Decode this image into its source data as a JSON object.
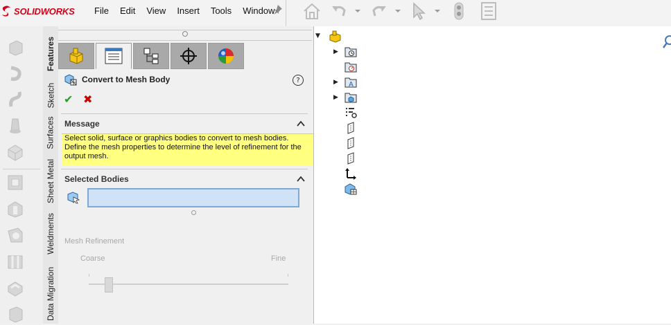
{
  "app": {
    "brand": "SOLIDWORKS",
    "brand_prefix": "3S",
    "brand_color": "#d0021b"
  },
  "menu": {
    "items": [
      "File",
      "Edit",
      "View",
      "Insert",
      "Tools",
      "Window"
    ]
  },
  "toolbar": {
    "icons": [
      "home-icon",
      "undo-icon",
      "dropdown-icon",
      "redo-icon",
      "dropdown-icon",
      "select-icon",
      "dropdown-icon",
      "toggle-icon",
      "options-icon"
    ]
  },
  "left_icons": [
    "extrude-boss-icon",
    "revolve-boss-icon",
    "sweep-boss-icon",
    "loft-boss-icon",
    "boundary-boss-icon",
    "extrude-cut-icon",
    "hole-wizard-icon",
    "revolve-cut-icon",
    "swept-cut-icon",
    "lofted-cut-icon",
    "boundary-cut-icon"
  ],
  "vertical_tabs": [
    "Features",
    "Sketch",
    "Surfaces",
    "Sheet Metal",
    "Weldments",
    "Data Migration"
  ],
  "manager_tabs": [
    "feature-manager-icon",
    "property-manager-icon",
    "configuration-manager-icon",
    "dimxpert-manager-icon",
    "display-manager-icon"
  ],
  "property_manager": {
    "title": "Convert to Mesh Body",
    "help": "?",
    "ok": "✔",
    "cancel": "✖",
    "message": {
      "title": "Message",
      "text": "Select solid, surface or graphics bodies to convert to mesh bodies. Define the mesh properties to determine the level of refinement for the output mesh."
    },
    "selected_bodies": {
      "title": "Selected Bodies",
      "value": ""
    },
    "mesh_refinement": {
      "title": "Mesh Refinement",
      "coarse_label": "Coarse",
      "fine_label": "Fine",
      "level": 0.1
    }
  },
  "feature_tree": {
    "items": [
      {
        "icon": "part-icon",
        "expandable": "down"
      },
      {
        "icon": "history-folder-icon",
        "expandable": "right"
      },
      {
        "icon": "sensors-folder-icon",
        "expandable": ""
      },
      {
        "icon": "annotations-folder-icon",
        "expandable": "right"
      },
      {
        "icon": "solid-bodies-folder-icon",
        "expandable": "right"
      },
      {
        "icon": "material-icon",
        "expandable": ""
      },
      {
        "icon": "front-plane-icon",
        "expandable": ""
      },
      {
        "icon": "top-plane-icon",
        "expandable": ""
      },
      {
        "icon": "right-plane-icon",
        "expandable": ""
      },
      {
        "icon": "origin-icon",
        "expandable": ""
      },
      {
        "icon": "mesh-body-icon",
        "expandable": ""
      }
    ]
  }
}
